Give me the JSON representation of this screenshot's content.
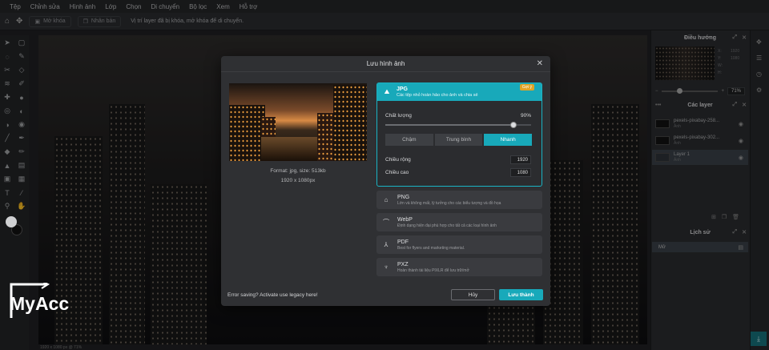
{
  "menu": [
    "Tệp",
    "Chỉnh sửa",
    "Hình ảnh",
    "Lớp",
    "Chọn",
    "Di chuyển",
    "Bộ lọc",
    "Xem",
    "Hỗ trợ"
  ],
  "toolbar": {
    "unlock_label": "Mở khóa",
    "duplicate_label": "Nhân bản",
    "message": "Vị trí layer đã bị khóa, mở khóa để di chuyển."
  },
  "status": "1920 x 1080 px @ 71%",
  "panels": {
    "navigator": {
      "title": "Điều hướng",
      "labels": [
        "X:",
        "Y:",
        "W:",
        "H:"
      ],
      "values": [
        "",
        "",
        "1920",
        "1080"
      ],
      "zoom": "71%"
    },
    "layers": {
      "title": "Các layer",
      "items": [
        {
          "name": "pexels-pixabay-258...",
          "sub": "Ảnh"
        },
        {
          "name": "pexels-pixabay-302...",
          "sub": "Ảnh"
        },
        {
          "name": "Layer 1",
          "sub": "Ảnh"
        }
      ]
    },
    "history": {
      "title": "Lịch sử",
      "items": [
        "Mở"
      ]
    }
  },
  "dialog": {
    "title": "Lưu hình ảnh",
    "file_format": "Format: jpg, size: 513kb",
    "file_dims": "1920 x 1080px",
    "formats": {
      "jpg": {
        "name": "JPG",
        "desc": "Các tệp nhỏ hoàn hảo cho ảnh và chia sẻ",
        "badge": "Gợi ý"
      },
      "png": {
        "name": "PNG",
        "desc": "Lớn và không mất, lý tưởng cho các biểu tượng và đồ họa"
      },
      "webp": {
        "name": "WebP",
        "desc": "Định dạng hiện đại phù hợp cho tất cả các loại hình ảnh"
      },
      "pdf": {
        "name": "PDF",
        "desc": "Best for flyers and marketing material."
      },
      "pxz": {
        "name": "PXZ",
        "desc": "Hoàn thành tài liệu PIXLR để lưu trữ/mở"
      }
    },
    "quality_label": "Chất lượng",
    "quality_value": "90%",
    "quality": 0.9,
    "speed_options": [
      "Chậm",
      "Trung bình",
      "Nhanh"
    ],
    "speed_selected": "Nhanh",
    "width_label": "Chiều rộng",
    "width_value": "1920",
    "height_label": "Chiều cao",
    "height_value": "1080",
    "error_text": "Error saving? Activate use legacy here!",
    "cancel_label": "Hủy",
    "save_label": "Lưu thành"
  },
  "logo_text": "MyAcc",
  "colors": {
    "accent": "#18a9ba",
    "badge": "#e0a425",
    "panel": "#2a2b2e",
    "modal": "#2f3033"
  }
}
